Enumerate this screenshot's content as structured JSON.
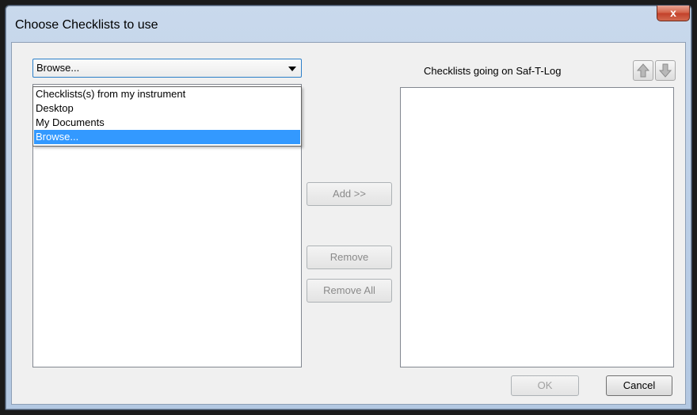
{
  "window": {
    "title": "Choose Checklists to use",
    "close_label": "x"
  },
  "source": {
    "selected": "Browse...",
    "options": [
      {
        "label": "Checklists(s) from my instrument",
        "selected": false
      },
      {
        "label": "Desktop",
        "selected": false
      },
      {
        "label": "My Documents",
        "selected": false
      },
      {
        "label": "Browse...",
        "selected": true
      }
    ]
  },
  "target": {
    "label": "Checklists going on Saf-T-Log"
  },
  "actions": {
    "add": "Add >>",
    "remove": "Remove",
    "remove_all": "Remove All"
  },
  "footer": {
    "ok": "OK",
    "cancel": "Cancel"
  },
  "icons": {
    "move_up": "arrow-up-icon",
    "move_down": "arrow-down-icon"
  },
  "colors": {
    "selection": "#3399ff",
    "close_button": "#c2402a"
  }
}
